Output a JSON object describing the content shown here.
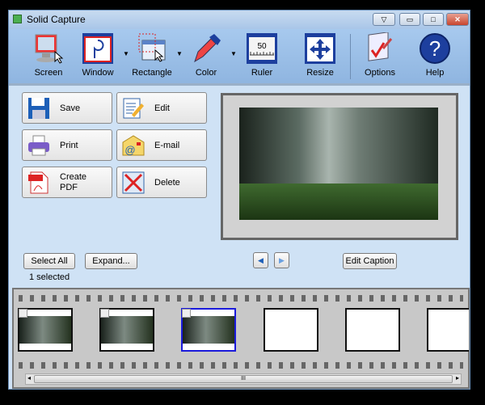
{
  "window": {
    "title": "Solid Capture",
    "controls": {
      "menu": "▽",
      "minimize": "▭",
      "maximize": "□",
      "close": "✕"
    }
  },
  "toolbar": {
    "items": [
      {
        "label": "Screen",
        "icon": "monitor-icon"
      },
      {
        "label": "Window",
        "icon": "window-capture-icon",
        "dropdown": true
      },
      {
        "label": "Rectangle",
        "icon": "rectangle-select-icon",
        "dropdown": true
      },
      {
        "label": "Color",
        "icon": "eyedropper-icon",
        "dropdown": true
      },
      {
        "label": "Ruler",
        "icon": "ruler-icon",
        "ruler_value": "50"
      },
      {
        "label": "Resize",
        "icon": "resize-arrows-icon"
      },
      {
        "label": "Options",
        "icon": "options-icon"
      },
      {
        "label": "Help",
        "icon": "help-icon",
        "glyph": "?"
      }
    ],
    "dropdown_glyph": "▼"
  },
  "actions": [
    {
      "label": "Save",
      "icon": "floppy-disk-icon"
    },
    {
      "label": "Edit",
      "icon": "edit-document-icon"
    },
    {
      "label": "Print",
      "icon": "printer-icon"
    },
    {
      "label": "E-mail",
      "icon": "email-envelope-icon"
    },
    {
      "label": "Create PDF",
      "icon": "pdf-icon"
    },
    {
      "label": "Delete",
      "icon": "delete-x-icon"
    }
  ],
  "controls": {
    "select_all": "Select All",
    "expand": "Expand...",
    "prev": "◀",
    "next": "▶",
    "edit_caption": "Edit Caption",
    "selection_status": "1 selected"
  },
  "filmstrip": {
    "thumbnails": [
      {
        "has_image": true,
        "selected": false
      },
      {
        "has_image": true,
        "selected": false
      },
      {
        "has_image": true,
        "selected": true
      },
      {
        "has_image": false
      },
      {
        "has_image": false
      },
      {
        "has_image": false
      }
    ],
    "scroll_grip": "III",
    "scroll_left": "◂",
    "scroll_right": "▸"
  },
  "colors": {
    "accent": "#1a1adb",
    "body": "#cfe2f5",
    "toolbar": "#a7c9ee"
  }
}
